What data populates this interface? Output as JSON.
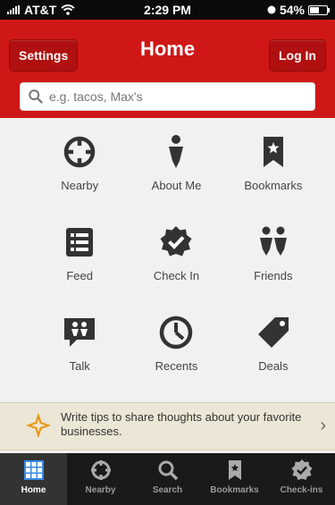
{
  "status": {
    "carrier": "AT&T",
    "time": "2:29 PM",
    "battery": "54%"
  },
  "nav": {
    "title": "Home",
    "settings_label": "Settings",
    "login_label": "Log In"
  },
  "search": {
    "placeholder": "e.g. tacos, Max's"
  },
  "grid": [
    {
      "label": "Nearby",
      "icon": "crosshair-icon"
    },
    {
      "label": "About Me",
      "icon": "person-icon"
    },
    {
      "label": "Bookmarks",
      "icon": "bookmark-icon"
    },
    {
      "label": "Feed",
      "icon": "feed-list-icon"
    },
    {
      "label": "Check In",
      "icon": "check-badge-icon"
    },
    {
      "label": "Friends",
      "icon": "friends-icon"
    },
    {
      "label": "Talk",
      "icon": "talk-bubble-icon"
    },
    {
      "label": "Recents",
      "icon": "clock-icon"
    },
    {
      "label": "Deals",
      "icon": "tag-icon"
    }
  ],
  "tip": {
    "text": "Write tips to share thoughts about your favorite businesses."
  },
  "tabs": [
    {
      "label": "Home",
      "icon": "home-grid-icon",
      "active": true
    },
    {
      "label": "Nearby",
      "icon": "crosshair-icon",
      "active": false
    },
    {
      "label": "Search",
      "icon": "search-icon",
      "active": false
    },
    {
      "label": "Bookmarks",
      "icon": "bookmark-icon",
      "active": false
    },
    {
      "label": "Check-ins",
      "icon": "check-badge-icon",
      "active": false
    }
  ],
  "colors": {
    "brand_red": "#cf1717",
    "tabbar": "#1a1a1a"
  }
}
